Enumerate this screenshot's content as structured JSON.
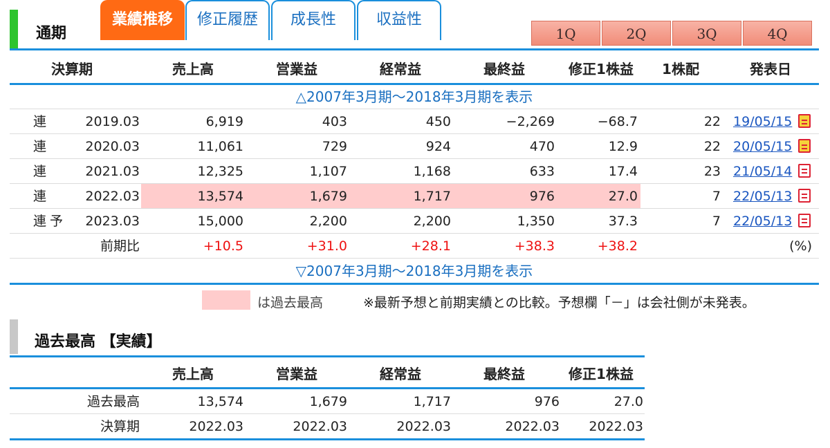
{
  "tabs": {
    "static_label": "通期",
    "items": [
      {
        "label": "業績推移",
        "active": true
      },
      {
        "label": "修正履歴",
        "active": false
      },
      {
        "label": "成長性",
        "active": false
      },
      {
        "label": "収益性",
        "active": false
      }
    ],
    "quarters": [
      "1Q",
      "2Q",
      "3Q",
      "4Q"
    ]
  },
  "table": {
    "headers": [
      "決算期",
      "売上高",
      "営業益",
      "経常益",
      "最終益",
      "修正1株益",
      "1株配",
      "発表日"
    ],
    "toggle_top": "△2007年3月期～2018年3月期を表示",
    "toggle_bottom": "▽2007年3月期～2018年3月期を表示",
    "rows": [
      {
        "kind": "連",
        "forecast": "",
        "period": "2019.03",
        "sales": "6,919",
        "op": "403",
        "ord": "450",
        "net": "−2,269",
        "eps": "−68.7",
        "div": "22",
        "date": "19/05/15",
        "icon": "announcement-icon",
        "highlight": false
      },
      {
        "kind": "連",
        "forecast": "",
        "period": "2020.03",
        "sales": "11,061",
        "op": "729",
        "ord": "924",
        "net": "470",
        "eps": "12.9",
        "div": "22",
        "date": "20/05/15",
        "icon": "announcement-icon",
        "highlight": false
      },
      {
        "kind": "連",
        "forecast": "",
        "period": "2021.03",
        "sales": "12,325",
        "op": "1,107",
        "ord": "1,168",
        "net": "633",
        "eps": "17.4",
        "div": "23",
        "date": "21/05/14",
        "icon": "pdf-icon",
        "highlight": false
      },
      {
        "kind": "連",
        "forecast": "",
        "period": "2022.03",
        "sales": "13,574",
        "op": "1,679",
        "ord": "1,717",
        "net": "976",
        "eps": "27.0",
        "div": "7",
        "date": "22/05/13",
        "icon": "pdf-icon",
        "highlight": true
      },
      {
        "kind": "連",
        "forecast": "予",
        "period": "2023.03",
        "sales": "15,000",
        "op": "2,200",
        "ord": "2,200",
        "net": "1,350",
        "eps": "37.3",
        "div": "7",
        "date": "22/05/13",
        "icon": "pdf-icon",
        "highlight": false
      }
    ],
    "yoy": {
      "label": "前期比",
      "sales": "+10.5",
      "op": "+31.0",
      "ord": "+28.1",
      "net": "+38.3",
      "eps": "+38.2",
      "unit": "(%)"
    }
  },
  "legend": {
    "text": "は過去最高",
    "note": "※最新予想と前期実績との比較。予想欄「－」は会社側が未発表。",
    "highlight_color": "#ffcccc"
  },
  "record": {
    "title": "過去最高 【実績】",
    "headers": [
      "売上高",
      "営業益",
      "経常益",
      "最終益",
      "修正1株益"
    ],
    "rows": [
      {
        "label": "過去最高",
        "values": [
          "13,574",
          "1,679",
          "1,717",
          "976",
          "27.0"
        ]
      },
      {
        "label": "決算期",
        "values": [
          "2022.03",
          "2022.03",
          "2022.03",
          "2022.03",
          "2022.03"
        ]
      }
    ]
  },
  "colors": {
    "accent": "#1a8fdc",
    "active_tab": "#ff6a14",
    "positive": "#ee1111",
    "green_marker": "#2ec42e"
  }
}
